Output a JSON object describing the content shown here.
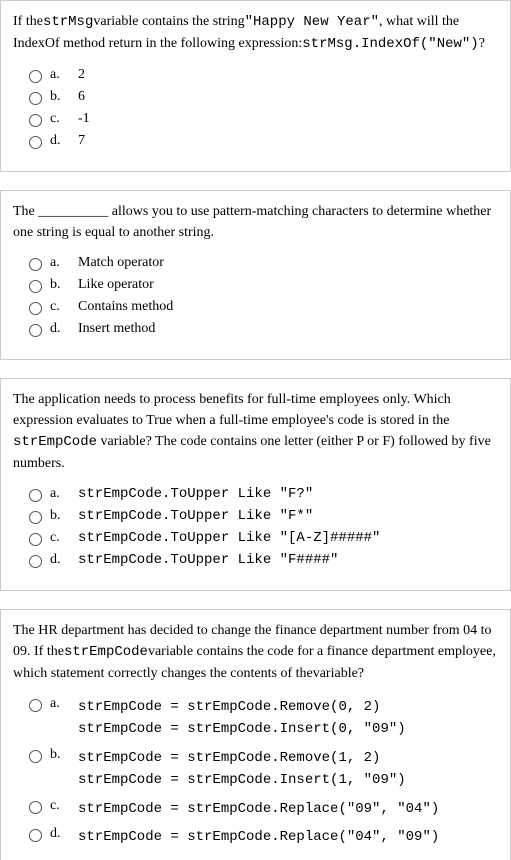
{
  "q1": {
    "text_pre": "If the",
    "code1": "strMsg",
    "text_mid1": "variable contains the string",
    "code2": "\"Happy New Year\"",
    "text_mid2": ", what will the IndexOf method return in the following expression:",
    "code3": "strMsg.IndexOf(\"New\")",
    "text_end": "?",
    "opts": {
      "a": {
        "label": "a.",
        "text": "2"
      },
      "b": {
        "label": "b.",
        "text": "6"
      },
      "c": {
        "label": "c.",
        "text": "-1"
      },
      "d": {
        "label": "d.",
        "text": "7"
      }
    }
  },
  "q2": {
    "text": "The __________ allows you to use pattern-matching characters to determine whether one string is equal to another string.",
    "opts": {
      "a": {
        "label": "a.",
        "text": "Match operator"
      },
      "b": {
        "label": "b.",
        "text": "Like operator"
      },
      "c": {
        "label": "c.",
        "text": "Contains method"
      },
      "d": {
        "label": "d.",
        "text": "Insert method"
      }
    }
  },
  "q3": {
    "text_pre": "The application needs to process benefits for full-time employees only. Which expression evaluates to True when a full-time employee's code is stored in the ",
    "code1": "strEmpCode",
    "text_post": " variable? The code contains one letter (either P or F) followed by five numbers.",
    "opts": {
      "a": {
        "label": "a.",
        "text": "strEmpCode.ToUpper Like \"F?\""
      },
      "b": {
        "label": "b.",
        "text": "strEmpCode.ToUpper Like \"F*\""
      },
      "c": {
        "label": "c.",
        "text": "strEmpCode.ToUpper Like \"[A-Z]#####\""
      },
      "d": {
        "label": "d.",
        "text": "strEmpCode.ToUpper Like \"F####\""
      }
    }
  },
  "q4": {
    "text_pre": "The HR department has decided to change the finance department number from 04 to 09. If the",
    "code1": "strEmpCode",
    "text_post": "variable contains the code for a finance department employee, which statement correctly changes the contents of thevariable?",
    "opts": {
      "a": {
        "label": "a.",
        "line1": "strEmpCode = strEmpCode.Remove(0, 2)",
        "line2": "strEmpCode = strEmpCode.Insert(0, \"09\")"
      },
      "b": {
        "label": "b.",
        "line1": "strEmpCode = strEmpCode.Remove(1, 2)",
        "line2": "strEmpCode = strEmpCode.Insert(1, \"09\")"
      },
      "c": {
        "label": "c.",
        "line1": "strEmpCode = strEmpCode.Replace(\"09\", \"04\")"
      },
      "d": {
        "label": "d.",
        "line1": "strEmpCode = strEmpCode.Replace(\"04\", \"09\")"
      }
    }
  }
}
